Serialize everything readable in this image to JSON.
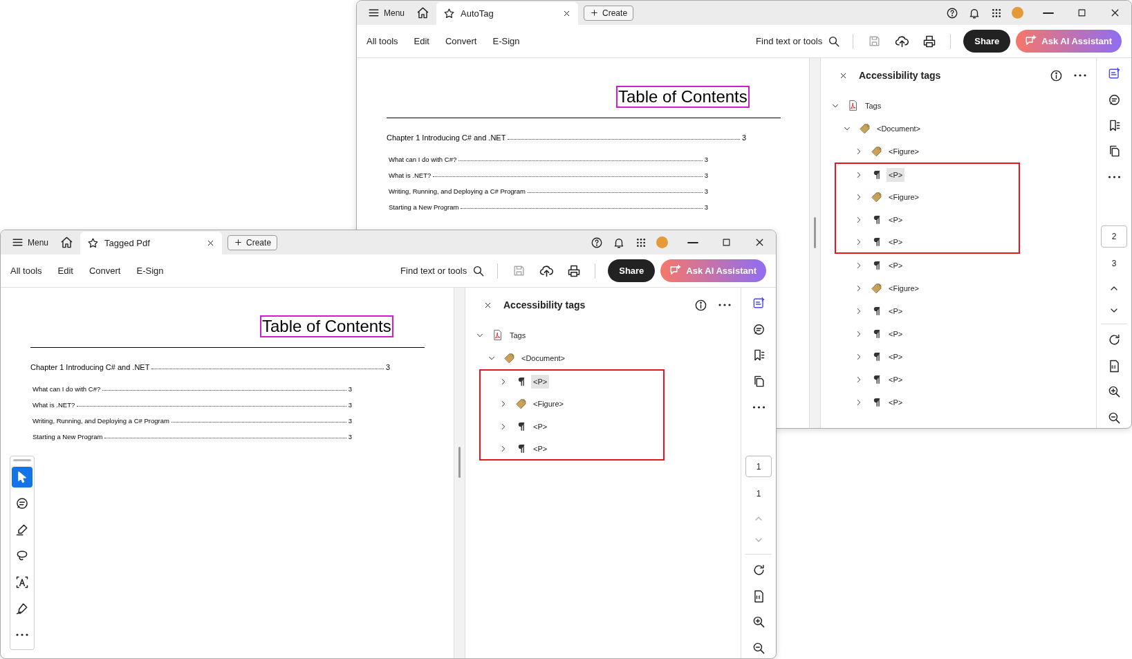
{
  "windows": [
    {
      "kind": "back",
      "menu": "Menu",
      "tab": {
        "title": "AutoTag"
      },
      "create": "Create",
      "toolbar": {
        "items": [
          "All tools",
          "Edit",
          "Convert",
          "E-Sign"
        ],
        "search": "Find text or tools",
        "share": "Share",
        "ai": "Ask AI Assistant"
      },
      "document": {
        "heading": "Table of Contents",
        "entries": [
          {
            "kind": "chapter",
            "title": "Chapter 1 Introducing C# and .NET",
            "page": "3"
          },
          {
            "kind": "section",
            "title": "What can I do with C#?",
            "page": "3"
          },
          {
            "kind": "section",
            "title": "What is .NET?",
            "page": "3"
          },
          {
            "kind": "section",
            "title": "Writing, Running, and Deploying a C# Program",
            "page": "3"
          },
          {
            "kind": "section",
            "title": "Starting a New Program",
            "page": "3"
          }
        ]
      },
      "panel": {
        "title": "Accessibility tags",
        "tree": [
          {
            "kind": "root",
            "label": "Tags",
            "expanded": true,
            "selected": false,
            "boxed": false,
            "children": [
              {
                "kind": "tag",
                "label": "<Document>",
                "expanded": true,
                "selected": false,
                "boxed": false,
                "children": [
                  {
                    "kind": "tag",
                    "label": "<Figure>",
                    "expanded": false,
                    "selected": false,
                    "boxed": false
                  },
                  {
                    "kind": "para",
                    "label": "<P>",
                    "expanded": false,
                    "selected": true,
                    "boxed": true
                  },
                  {
                    "kind": "tag",
                    "label": "<Figure>",
                    "expanded": false,
                    "selected": false,
                    "boxed": true
                  },
                  {
                    "kind": "para",
                    "label": "<P>",
                    "expanded": false,
                    "selected": false,
                    "boxed": true
                  },
                  {
                    "kind": "para",
                    "label": "<P>",
                    "expanded": false,
                    "selected": false,
                    "boxed": true
                  },
                  {
                    "kind": "para",
                    "label": "<P>",
                    "expanded": false,
                    "selected": false,
                    "boxed": false
                  },
                  {
                    "kind": "tag",
                    "label": "<Figure>",
                    "expanded": false,
                    "selected": false,
                    "boxed": false
                  },
                  {
                    "kind": "para",
                    "label": "<P>",
                    "expanded": false,
                    "selected": false,
                    "boxed": false
                  },
                  {
                    "kind": "para",
                    "label": "<P>",
                    "expanded": false,
                    "selected": false,
                    "boxed": false
                  },
                  {
                    "kind": "para",
                    "label": "<P>",
                    "expanded": false,
                    "selected": false,
                    "boxed": false
                  },
                  {
                    "kind": "para",
                    "label": "<P>",
                    "expanded": false,
                    "selected": false,
                    "boxed": false
                  },
                  {
                    "kind": "para",
                    "label": "<P>",
                    "expanded": false,
                    "selected": false,
                    "boxed": false
                  }
                ]
              }
            ]
          }
        ]
      },
      "rail": {
        "pages": [
          {
            "label": "2",
            "selected": true
          },
          {
            "label": "3",
            "selected": false
          }
        ],
        "up_disabled": false,
        "down_disabled": false
      }
    },
    {
      "kind": "front",
      "menu": "Menu",
      "tab": {
        "title": "Tagged Pdf"
      },
      "create": "Create",
      "toolbar": {
        "items": [
          "All tools",
          "Edit",
          "Convert",
          "E-Sign"
        ],
        "search": "Find text or tools",
        "share": "Share",
        "ai": "Ask AI Assistant"
      },
      "document": {
        "heading": "Table of Contents",
        "entries": [
          {
            "kind": "chapter",
            "title": "Chapter 1 Introducing C# and .NET",
            "page": "3"
          },
          {
            "kind": "section",
            "title": "What can I do with C#?",
            "page": "3"
          },
          {
            "kind": "section",
            "title": "What is .NET?",
            "page": "3"
          },
          {
            "kind": "section",
            "title": "Writing, Running, and Deploying a C# Program",
            "page": "3"
          },
          {
            "kind": "section",
            "title": "Starting a New Program",
            "page": "3"
          }
        ]
      },
      "tool_palette": [
        {
          "kind": "select",
          "selected": true
        },
        {
          "kind": "comment",
          "selected": false
        },
        {
          "kind": "highlight",
          "selected": false
        },
        {
          "kind": "draw",
          "selected": false
        },
        {
          "kind": "text",
          "selected": false
        },
        {
          "kind": "sign",
          "selected": false
        },
        {
          "kind": "more",
          "selected": false
        }
      ],
      "panel": {
        "title": "Accessibility tags",
        "tree": [
          {
            "kind": "root",
            "label": "Tags",
            "expanded": true,
            "selected": false,
            "boxed": false,
            "children": [
              {
                "kind": "tag",
                "label": "<Document>",
                "expanded": true,
                "selected": false,
                "boxed": false,
                "children": [
                  {
                    "kind": "para",
                    "label": "<P>",
                    "expanded": false,
                    "selected": true,
                    "boxed": true
                  },
                  {
                    "kind": "tag",
                    "label": "<Figure>",
                    "expanded": false,
                    "selected": false,
                    "boxed": true
                  },
                  {
                    "kind": "para",
                    "label": "<P>",
                    "expanded": false,
                    "selected": false,
                    "boxed": true
                  },
                  {
                    "kind": "para",
                    "label": "<P>",
                    "expanded": false,
                    "selected": false,
                    "boxed": true
                  }
                ]
              }
            ]
          }
        ]
      },
      "rail": {
        "pages": [
          {
            "label": "1",
            "selected": true
          },
          {
            "label": "1",
            "selected": false
          }
        ],
        "up_disabled": true,
        "down_disabled": true
      }
    }
  ]
}
